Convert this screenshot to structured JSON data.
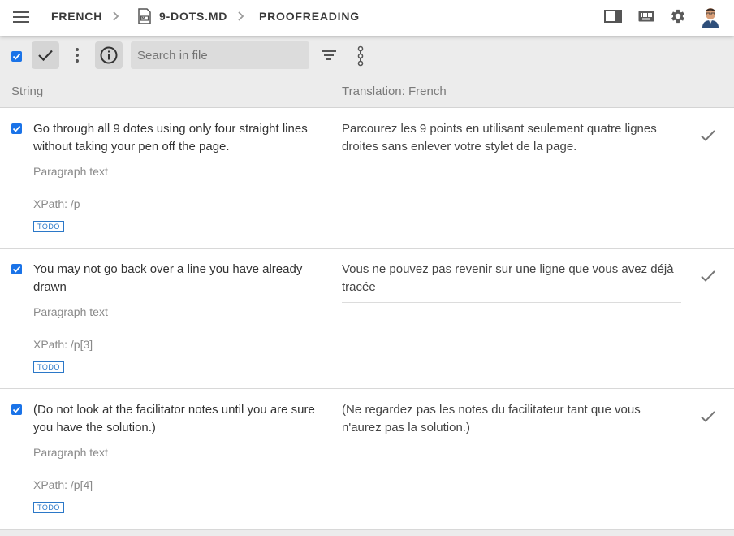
{
  "breadcrumb": {
    "project": "FRENCH",
    "file": "9-DOTS.MD",
    "step": "PROOFREADING"
  },
  "icons": {
    "menu": "hamburger-menu-icon",
    "file": "markdown-file-icon",
    "panel": "side-panel-icon",
    "keyboard": "keyboard-icon",
    "settings": "gear-icon",
    "avatar": "user-avatar"
  },
  "toolbar": {
    "search_placeholder": "Search in file"
  },
  "columns": {
    "string": "String",
    "translation": "Translation: French"
  },
  "rows": [
    {
      "source": "Go through all 9 dotes using only four straight lines without taking your pen off the page.",
      "type": "Paragraph text",
      "xpath": "XPath: /p",
      "status": "TODO",
      "translation": "Parcourez les 9 points en utilisant seulement quatre lignes droites sans enlever votre stylet de la page."
    },
    {
      "source": "You may not go back over a line you have already drawn",
      "type": "Paragraph text",
      "xpath": "XPath: /p[3]",
      "status": "TODO",
      "translation": "Vous ne pouvez pas revenir sur une ligne que vous avez déjà tracée"
    },
    {
      "source": "(Do not look at the facilitator notes until you are sure you have the solution.)",
      "type": "Paragraph text",
      "xpath": "XPath: /p[4]",
      "status": "TODO",
      "translation": "(Ne regardez pas les notes du facilitateur tant que vous n'aurez pas la solution.)"
    }
  ],
  "colors": {
    "accent": "#1a73e8",
    "toolbar_bg": "#ececec",
    "todo_badge": "#2b78c8"
  }
}
